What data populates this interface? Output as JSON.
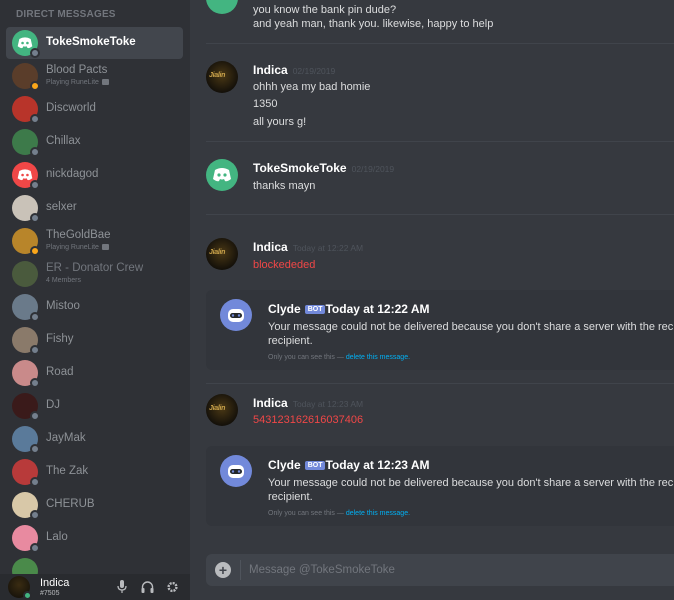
{
  "sidebar": {
    "header": "Direct Messages",
    "items": [
      {
        "name": "TokeSmokeToke",
        "sub": "",
        "selected": true,
        "status": "offline",
        "avatar_color": "#43b581",
        "avatar_kind": "discord"
      },
      {
        "name": "Blood Pacts",
        "sub": "Playing RuneLite",
        "status": "idle",
        "avatar_color": "#5a3d2a",
        "rich": true
      },
      {
        "name": "Discworld",
        "sub": "",
        "status": "offline",
        "avatar_color": "#b8342a"
      },
      {
        "name": "Chillax",
        "sub": "",
        "status": "offline",
        "avatar_color": "#3d7a4a"
      },
      {
        "name": "nickdagod",
        "sub": "",
        "status": "offline",
        "avatar_color": "#f04747",
        "avatar_kind": "discord"
      },
      {
        "name": "selxer",
        "sub": "",
        "status": "offline",
        "avatar_color": "#c9c2b8"
      },
      {
        "name": "TheGoldBae",
        "sub": "Playing RuneLite",
        "status": "idle",
        "avatar_color": "#b8852a",
        "rich": true
      },
      {
        "name": "ER - Donator Crew",
        "sub": "4 Members",
        "status": "none",
        "avatar_color": "#4a5a3d",
        "dim": true
      },
      {
        "name": "Mistoo",
        "sub": "",
        "status": "offline",
        "avatar_color": "#6a7a8a"
      },
      {
        "name": "Fishy",
        "sub": "",
        "status": "offline",
        "avatar_color": "#8a7a6a"
      },
      {
        "name": "Road",
        "sub": "",
        "status": "offline",
        "avatar_color": "#c98a8a"
      },
      {
        "name": "DJ",
        "sub": "",
        "status": "offline",
        "avatar_color": "#3a1a1a"
      },
      {
        "name": "JayMak",
        "sub": "",
        "status": "offline",
        "avatar_color": "#5a7a9a"
      },
      {
        "name": "The Zak",
        "sub": "",
        "status": "offline",
        "avatar_color": "#b83a3a"
      },
      {
        "name": "CHERUB",
        "sub": "",
        "status": "offline",
        "avatar_color": "#d8c8a8"
      },
      {
        "name": "Lalo",
        "sub": "",
        "status": "offline",
        "avatar_color": "#e88aa0"
      },
      {
        "name": "",
        "sub": "",
        "status": "offline",
        "avatar_color": "#4a8a4a"
      }
    ]
  },
  "user_panel": {
    "name": "Indica",
    "tag": "#7505",
    "mic_icon": "microphone-icon",
    "headphones_icon": "headphones-icon",
    "settings_icon": "gear-icon"
  },
  "chat": {
    "messages_top": {
      "line1": "you know the bank pin dude?",
      "line2": "and yeah man, thank you. likewise, happy to help"
    },
    "msg_indica_1": {
      "author": "Indica",
      "timestamp": "02/19/2019",
      "lines": [
        "ohhh yea my bad homie",
        "1350",
        "all yours g!"
      ]
    },
    "msg_toke": {
      "author": "TokeSmokeToke",
      "timestamp": "02/19/2019",
      "lines": [
        "thanks mayn"
      ]
    },
    "msg_indica_2": {
      "author": "Indica",
      "timestamp": "Today at 12:22 AM",
      "lines": [
        "blockededed"
      ]
    },
    "clyde_1": {
      "author": "Clyde",
      "bot_tag": "BOT",
      "timestamp": "Today at 12:22 AM",
      "line1": "Your message could not be delivered because you don't share a server with the rec",
      "line2": "recipient.",
      "note": "Only you can see this —",
      "note_link": "delete this message."
    },
    "msg_indica_3": {
      "author": "Indica",
      "timestamp": "Today at 12:23 AM",
      "lines": [
        "543123162616037406"
      ]
    },
    "clyde_2": {
      "author": "Clyde",
      "bot_tag": "BOT",
      "timestamp": "Today at 12:23 AM",
      "line1": "Your message could not be delivered because you don't share a server with the rec",
      "line2": "recipient.",
      "note": "Only you can see this —",
      "note_link": "delete this message."
    }
  },
  "input": {
    "placeholder": "Message @TokeSmokeToke",
    "add_icon": "plus-circle-icon"
  },
  "indica_avatar_text": "Jialin",
  "colors": {
    "accent": "#7289da",
    "online": "#43b581",
    "idle": "#faa61a",
    "error_text": "#f04747",
    "link": "#00b0f4"
  }
}
